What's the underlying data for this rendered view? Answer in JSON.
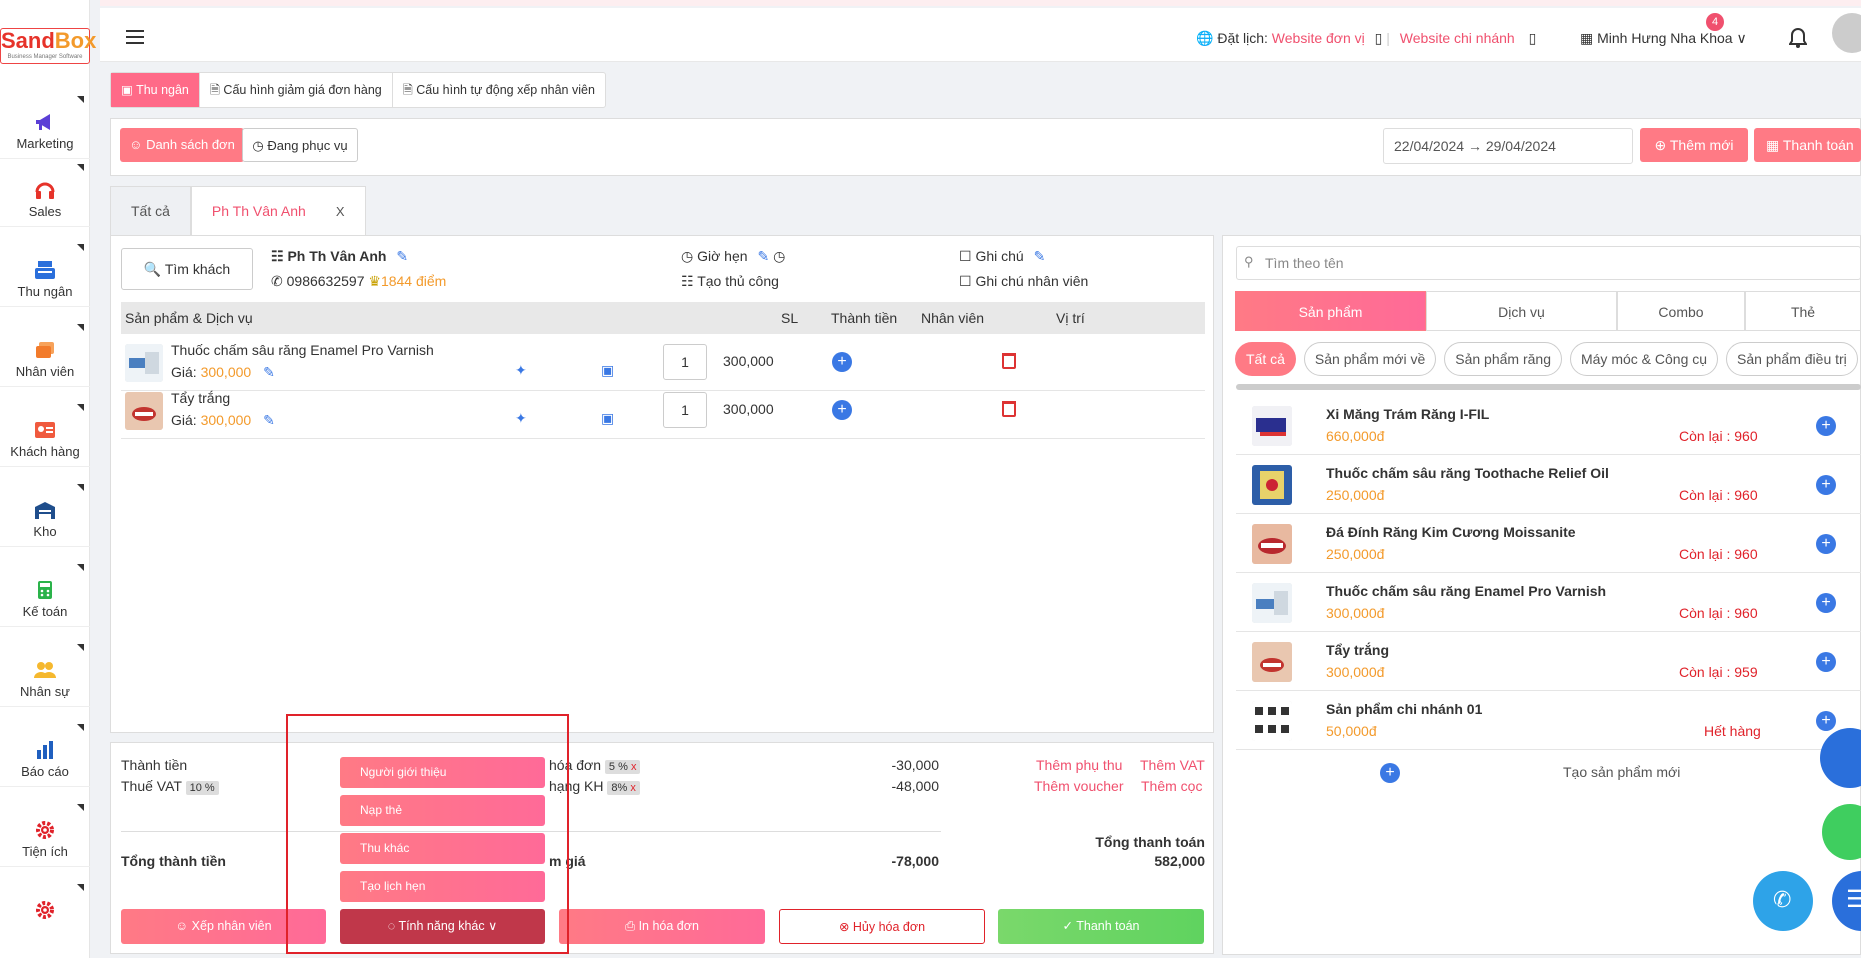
{
  "app": {
    "logo_text": "SandBox",
    "logo_sub": "Business Manager Software"
  },
  "sidebar": {
    "items": [
      {
        "label": "Marketing",
        "icon": "megaphone-icon"
      },
      {
        "label": "Sales",
        "icon": "headset-icon"
      },
      {
        "label": "Thu ngân",
        "icon": "cash-register-icon"
      },
      {
        "label": "Nhân viên",
        "icon": "id-card-icon"
      },
      {
        "label": "Khách hàng",
        "icon": "address-card-icon"
      },
      {
        "label": "Kho",
        "icon": "warehouse-icon"
      },
      {
        "label": "Kế toán",
        "icon": "calculator-icon"
      },
      {
        "label": "Nhân sự",
        "icon": "people-icon"
      },
      {
        "label": "Báo cáo",
        "icon": "bar-chart-icon"
      },
      {
        "label": "Tiện ích",
        "icon": "gear-icon"
      }
    ]
  },
  "header": {
    "booking_label": "Đặt lịch:",
    "website_unit": "Website đơn vị",
    "website_branch": "Website chi nhánh",
    "branch_name": "Minh Hưng Nha Khoa",
    "notification_count": "4"
  },
  "page_tabs": [
    "Thu ngân",
    "Cấu hình giảm giá đơn hàng",
    "Cấu hình tự động xếp nhân viên"
  ],
  "toolbar": {
    "order_list": "Danh sách đơn",
    "serving": "Đang phục vụ",
    "date_range": "22/04/2024 → 29/04/2024",
    "add_new": "Thêm mới",
    "pay": "Thanh toán"
  },
  "customer_tabs": {
    "all": "Tất cả",
    "active": "Ph Th Vân Anh",
    "close": "X"
  },
  "customer": {
    "search_button": "Tìm khách",
    "name": "Ph Th Vân Anh",
    "phone": "0986632597",
    "points": "1844 điểm",
    "appointment_label": "Giờ hẹn",
    "manual_create": "Tạo thủ công",
    "note_label": "Ghi chú",
    "staff_note_label": "Ghi chú nhân viên"
  },
  "order_table": {
    "headers": [
      "Sản phẩm & Dịch vụ",
      "SL",
      "Thành tiền",
      "Nhân viên",
      "Vị trí"
    ],
    "rows": [
      {
        "name": "Thuốc chấm sâu răng Enamel Pro Varnish",
        "price_label": "Giá:",
        "price": "300,000",
        "qty": "1",
        "total": "300,000"
      },
      {
        "name": "Tẩy trắng",
        "price_label": "Giá:",
        "price": "300,000",
        "qty": "1",
        "total": "300,000"
      }
    ]
  },
  "summary": {
    "subtotal_label": "Thành tiền",
    "vat_label": "Thuế VAT",
    "vat_tag": "10 %",
    "invoice_label": "hóa đơn",
    "invoice_tag": "5 %",
    "customer_rank_label": "hạng KH",
    "customer_rank_tag": "8%",
    "tag_remove": "x",
    "discount1": "-30,000",
    "discount2": "-48,000",
    "add_surcharge": "Thêm phụ thu",
    "add_vat": "Thêm VAT",
    "add_voucher": "Thêm voucher",
    "add_deposit": "Thêm cọc",
    "grand_label": "Tổng thành tiền",
    "discount_label": "m giá",
    "discount_total": "-78,000",
    "pay_total_label": "Tổng thanh toán",
    "pay_total": "582,000"
  },
  "more_menu": [
    "Người giới thiệu",
    "Nạp thẻ",
    "Thu khác",
    "Tạo lịch hẹn"
  ],
  "bottom_buttons": {
    "assign_staff": "Xếp nhân viên",
    "more_features": "Tính năng khác",
    "print": "In hóa đơn",
    "cancel": "Hủy hóa đơn",
    "checkout": "Thanh toán"
  },
  "products_panel": {
    "search_placeholder": "Tìm theo tên",
    "tabs": [
      "Sản phẩm",
      "Dịch vụ",
      "Combo",
      "Thẻ"
    ],
    "chips": [
      "Tất cả",
      "Sản phẩm mới về",
      "Sản phẩm răng",
      "Máy móc & Công cụ",
      "Sản phẩm điều trị"
    ],
    "items": [
      {
        "name": "Xi Măng Trám Răng I-FIL",
        "price": "660,000đ",
        "stock": "Còn lại : 960"
      },
      {
        "name": "Thuốc chấm sâu răng Toothache Relief Oil",
        "price": "250,000đ",
        "stock": "Còn lại : 960"
      },
      {
        "name": "Đá Đính Răng Kim Cương Moissanite",
        "price": "250,000đ",
        "stock": "Còn lại : 960"
      },
      {
        "name": "Thuốc chấm sâu răng Enamel Pro Varnish",
        "price": "300,000đ",
        "stock": "Còn lại : 960"
      },
      {
        "name": "Tẩy trắng",
        "price": "300,000đ",
        "stock": "Còn lại : 959"
      },
      {
        "name": "Sản phẩm chi nhánh 01",
        "price": "50,000đ",
        "stock": "Hết hàng"
      }
    ],
    "create_new": "Tạo sản phẩm mới"
  },
  "colors": {
    "accent": "#ff7a85",
    "brand_pink": "#f0506e",
    "primary_blue": "#3a78e4",
    "success": "#5fd35f",
    "danger": "#e0222a"
  }
}
